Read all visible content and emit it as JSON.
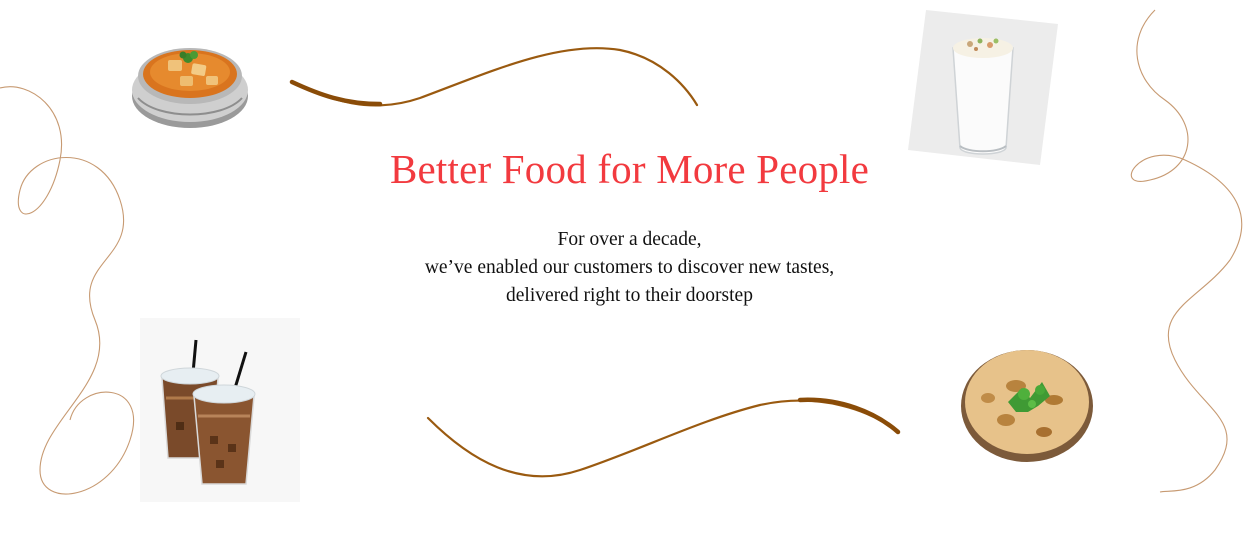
{
  "hero": {
    "headline": "Better Food for More People",
    "tagline_lines": [
      "For over a decade,",
      "we’ve enabled our customers to discover new tastes,",
      "delivered right to their doorstep"
    ]
  },
  "colors": {
    "headline": "#f23a3f",
    "text": "#111111",
    "swirl_brown": "#9a5a10",
    "thin_line": "#c79a72"
  },
  "illustrations": [
    "paneer-curry-bowl",
    "lassi-glass",
    "iced-coffee-cups",
    "paratha-plate"
  ]
}
